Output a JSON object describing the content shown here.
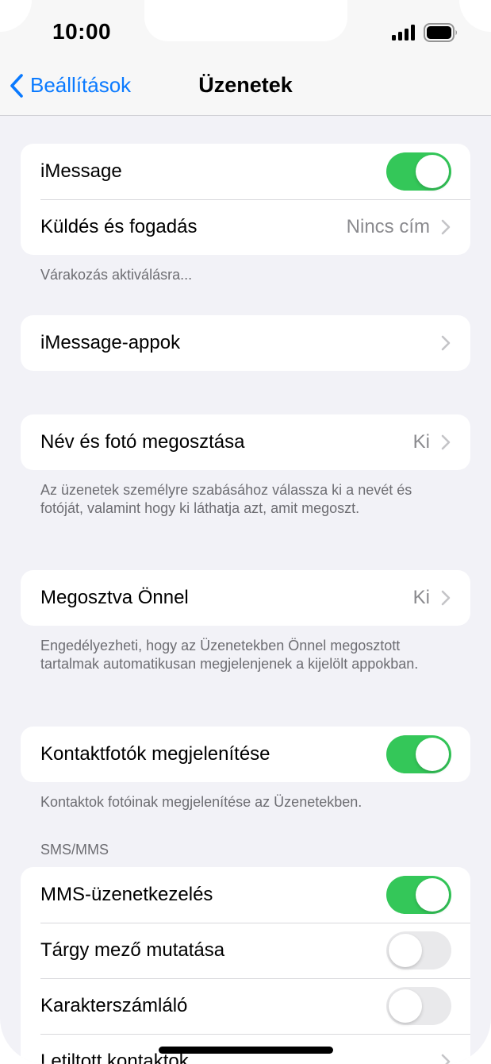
{
  "status": {
    "time": "10:00"
  },
  "nav": {
    "back_label": "Beállítások",
    "title": "Üzenetek"
  },
  "group1": {
    "imessage_label": "iMessage",
    "imessage_on": true,
    "send_receive_label": "Küldés és fogadás",
    "send_receive_value": "Nincs cím",
    "footer": "Várakozás aktiválásra..."
  },
  "group2": {
    "apps_label": "iMessage-appok"
  },
  "group3": {
    "name_photo_label": "Név és fotó megosztása",
    "name_photo_value": "Ki",
    "footer": "Az üzenetek személyre szabásához válassza ki a nevét és fotóját, valamint hogy ki láthatja azt, amit megoszt."
  },
  "group4": {
    "shared_label": "Megosztva Önnel",
    "shared_value": "Ki",
    "footer": "Engedélyezheti, hogy az Üzenetekben Önnel megosztott tartalmak automatikusan megjelenjenek a kijelölt appokban."
  },
  "group5": {
    "contact_photos_label": "Kontaktfotók megjelenítése",
    "contact_photos_on": true,
    "footer": "Kontaktok fotóinak megjelenítése az Üzenetekben."
  },
  "sms": {
    "header": "SMS/MMS",
    "mms_label": "MMS-üzenetkezelés",
    "mms_on": true,
    "subject_label": "Tárgy mező mutatása",
    "subject_on": false,
    "char_count_label": "Karakterszámláló",
    "char_count_on": false,
    "blocked_label": "Letiltott kontaktok"
  },
  "colors": {
    "accent": "#0a7aff",
    "toggle_on": "#34c759",
    "toggle_off": "#e9e9eb"
  }
}
